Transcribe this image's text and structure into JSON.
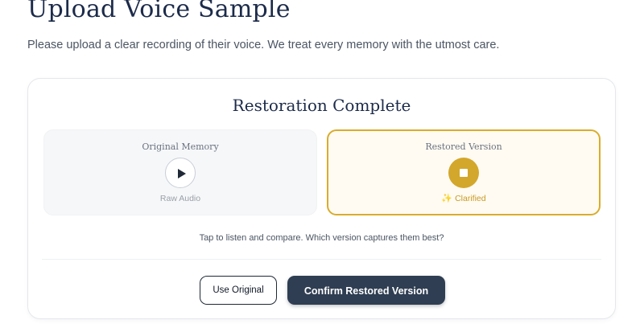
{
  "header": {
    "title": "Upload Voice Sample",
    "subtitle": "Please upload a clear recording of their voice. We treat every memory with the utmost care."
  },
  "card": {
    "title": "Restoration Complete",
    "original": {
      "label": "Original Memory",
      "caption": "Raw Audio",
      "control_icon": "play-icon"
    },
    "restored": {
      "label": "Restored Version",
      "caption": "Clarified",
      "caption_icon": "sparkle-icon",
      "control_icon": "stop-icon",
      "selected": true
    },
    "hint": "Tap to listen and compare. Which version captures them best?",
    "actions": {
      "use_original_label": "Use Original",
      "confirm_label": "Confirm Restored Version"
    }
  },
  "colors": {
    "heading": "#1c2b4a",
    "accent_gold": "#d3a72c",
    "accent_gold_text": "#c99a22",
    "restored_panel_bg": "#fffbf2",
    "original_panel_bg": "#f6f7f9",
    "primary_button": "#2f3e52"
  }
}
